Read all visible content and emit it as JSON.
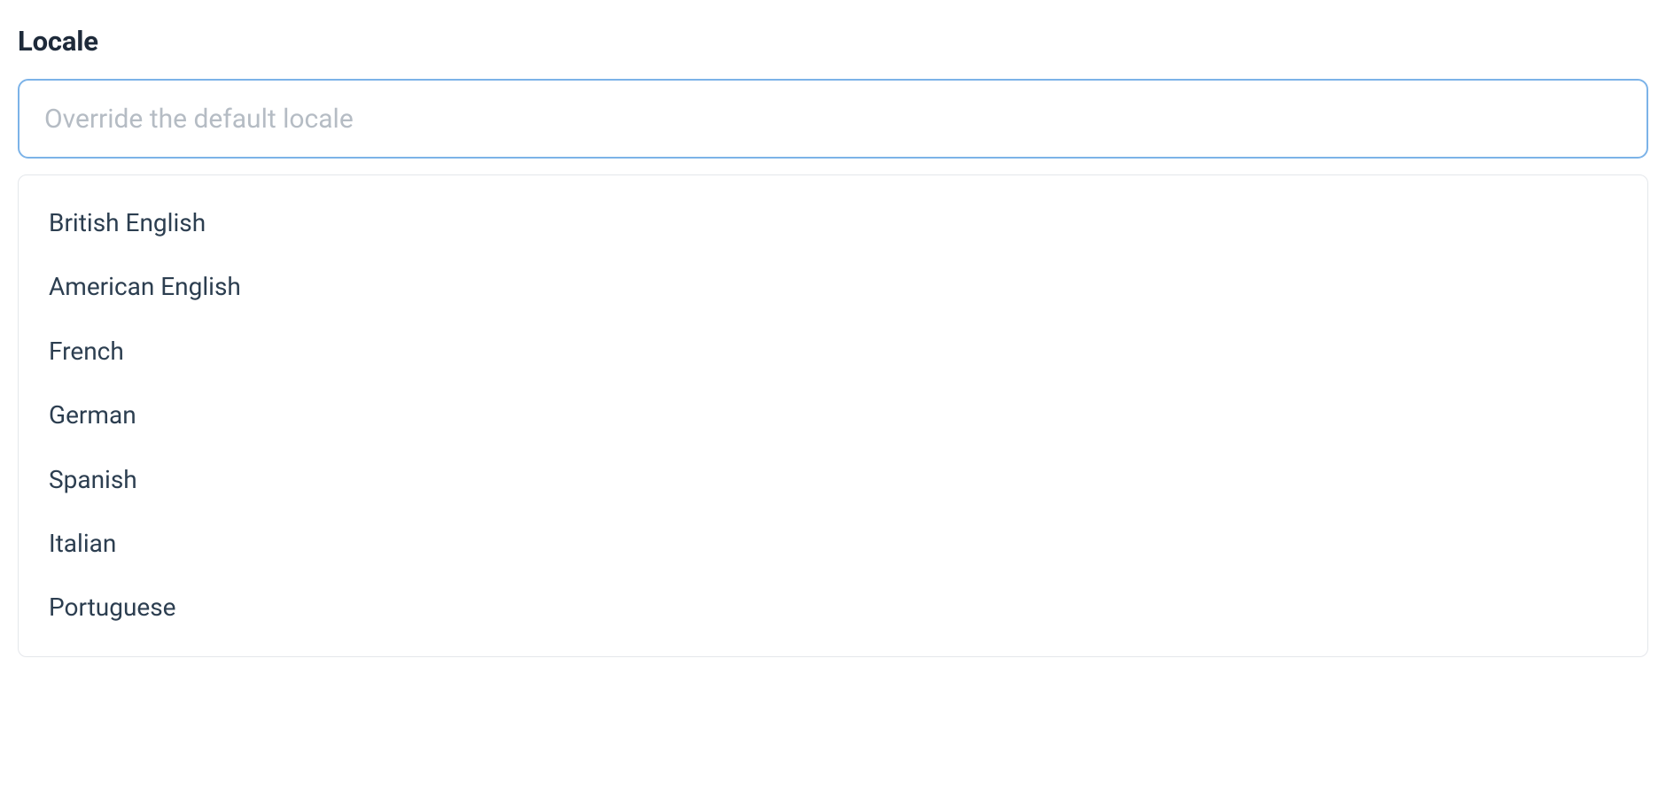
{
  "locale": {
    "label": "Locale",
    "placeholder": "Override the default locale",
    "value": "",
    "options": [
      "British English",
      "American English",
      "French",
      "German",
      "Spanish",
      "Italian",
      "Portuguese"
    ]
  }
}
